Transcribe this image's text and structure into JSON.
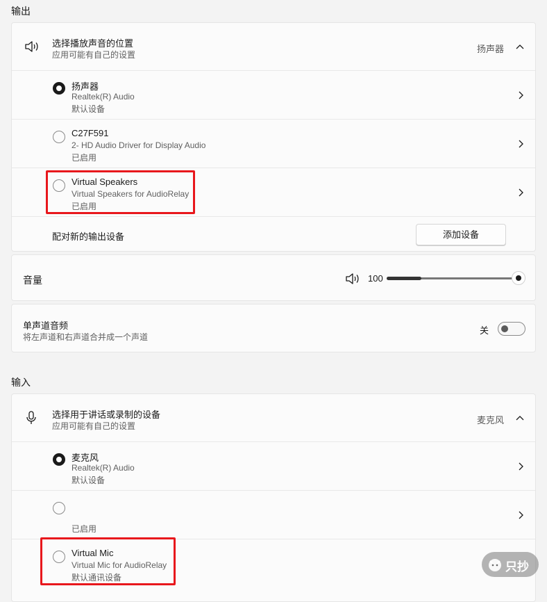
{
  "output": {
    "section_title": "输出",
    "header": {
      "title": "选择播放声音的位置",
      "subtitle": "应用可能有自己的设置",
      "value": "扬声器"
    },
    "devices": [
      {
        "name": "扬声器",
        "driver": "Realtek(R) Audio",
        "status": "默认设备",
        "selected": true
      },
      {
        "name": "C27F591",
        "driver": "2- HD Audio Driver for Display Audio",
        "status": "已启用",
        "selected": false
      },
      {
        "name": "Virtual Speakers",
        "driver": "Virtual Speakers for AudioRelay",
        "status": "已启用",
        "selected": false
      }
    ],
    "pair_label": "配对新的输出设备",
    "add_button": "添加设备"
  },
  "volume": {
    "label": "音量",
    "value": "100",
    "level_percent": 100
  },
  "mono": {
    "title": "单声道音频",
    "subtitle": "将左声道和右声道合并成一个声道",
    "state": "关"
  },
  "input": {
    "section_title": "输入",
    "header": {
      "title": "选择用于讲话或录制的设备",
      "subtitle": "应用可能有自己的设置",
      "value": "麦克风"
    },
    "devices": [
      {
        "name": "麦克风",
        "driver": "Realtek(R) Audio",
        "status": "默认设备",
        "selected": true
      },
      {
        "name": "",
        "driver": "",
        "status": "已启用",
        "selected": false
      },
      {
        "name": "Virtual Mic",
        "driver": "Virtual Mic for AudioRelay",
        "status": "默认通讯设备",
        "selected": false
      }
    ]
  },
  "watermark": "只抄",
  "colors": {
    "highlight": "#e8171c"
  }
}
